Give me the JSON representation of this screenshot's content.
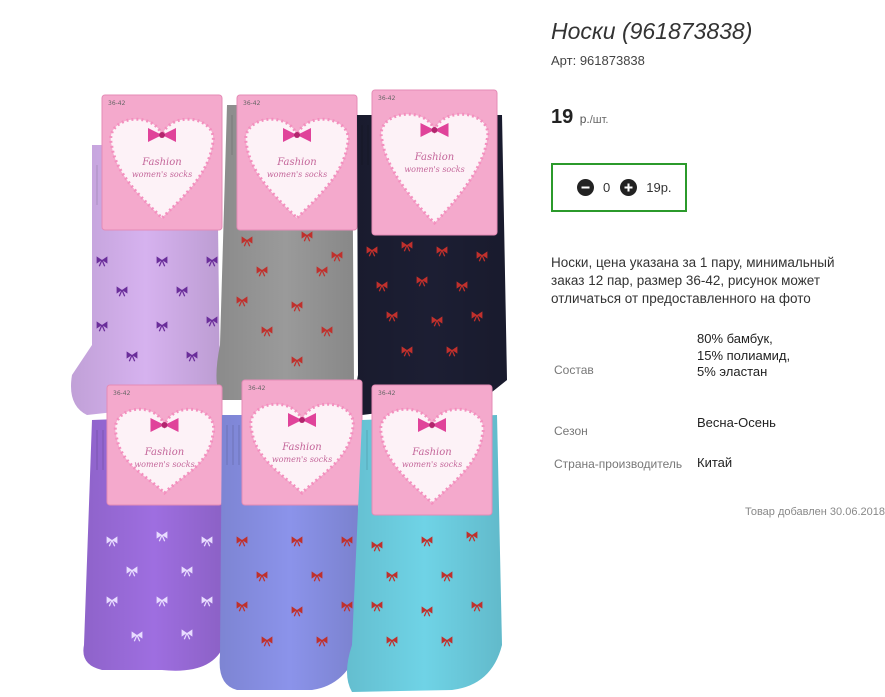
{
  "product": {
    "title": "Носки (961873838)",
    "sku_label": "Арт:",
    "sku_value": "961873838",
    "price_value": "19",
    "price_currency": "р.",
    "price_unit": "/шт.",
    "description": "Носки, цена указана за 1 пару, минимальный заказ 12 пар, размер 36-42, рисунок может отличаться от предоставленного на фото",
    "added": "Товар добавлен 30.06.2018"
  },
  "quantity": {
    "value": "0",
    "total": "19р.",
    "minus_icon": "minus-circle-icon",
    "plus_icon": "plus-circle-icon"
  },
  "properties": [
    {
      "name": "Состав",
      "value": "80% бамбук, 15% полиамид, 5% эластан"
    },
    {
      "name": "Сезон",
      "value": "Весна-Осень"
    },
    {
      "name": "Страна-производитель",
      "value": "Китай"
    }
  ],
  "photo": {
    "label_text_1": "Fashion",
    "label_text_2": "women's socks",
    "size_tag": "36-42",
    "colors": {
      "lilac": "#d6b2ef",
      "gray": "#9a9a9a",
      "navy": "#1c1e33",
      "purple": "#9e6ee0",
      "periwinkle": "#8b93ea",
      "turquoise": "#6fd3e6",
      "label_pink": "#f4a9cc",
      "border_accent": "#2b9a2b"
    }
  }
}
